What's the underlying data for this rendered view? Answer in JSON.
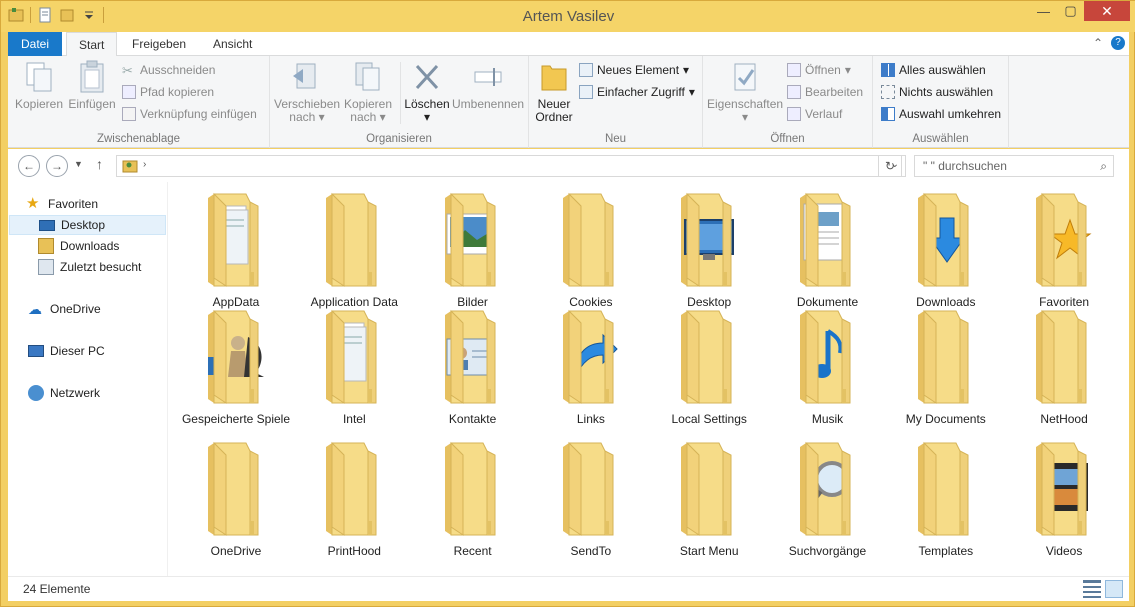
{
  "window": {
    "title": "Artem Vasilev"
  },
  "tabs": {
    "file": "Datei",
    "start": "Start",
    "share": "Freigeben",
    "view": "Ansicht"
  },
  "ribbon": {
    "clipboard": {
      "label": "Zwischenablage",
      "copy": "Kopieren",
      "paste": "Einfügen",
      "cut": "Ausschneiden",
      "copy_path": "Pfad kopieren",
      "paste_shortcut": "Verknüpfung einfügen"
    },
    "organize": {
      "label": "Organisieren",
      "move_to_1": "Verschieben",
      "move_to_2": "nach",
      "copy_to_1": "Kopieren",
      "copy_to_2": "nach",
      "delete": "Löschen",
      "rename": "Umbenennen"
    },
    "new": {
      "label": "Neu",
      "new_folder_1": "Neuer",
      "new_folder_2": "Ordner",
      "new_item": "Neues Element",
      "easy_access": "Einfacher Zugriff"
    },
    "open": {
      "label": "Öffnen",
      "properties": "Eigenschaften",
      "open": "Öffnen",
      "edit": "Bearbeiten",
      "history": "Verlauf"
    },
    "select": {
      "label": "Auswählen",
      "select_all": "Alles auswählen",
      "select_none": "Nichts auswählen",
      "invert": "Auswahl umkehren"
    }
  },
  "address": {
    "search_placeholder": "\"              \" durchsuchen"
  },
  "nav": {
    "favorites": "Favoriten",
    "desktop": "Desktop",
    "downloads": "Downloads",
    "recent": "Zuletzt besucht",
    "onedrive": "OneDrive",
    "thispc": "Dieser PC",
    "network": "Netzwerk"
  },
  "items": [
    {
      "label": "AppData",
      "icon": "papers"
    },
    {
      "label": "Application Data",
      "icon": "plain"
    },
    {
      "label": "Bilder",
      "icon": "picture"
    },
    {
      "label": "Cookies",
      "icon": "plain"
    },
    {
      "label": "Desktop",
      "icon": "monitor"
    },
    {
      "label": "Dokumente",
      "icon": "document"
    },
    {
      "label": "Downloads",
      "icon": "arrow-down"
    },
    {
      "label": "Favoriten",
      "icon": "star"
    },
    {
      "label": "Gespeicherte Spiele",
      "icon": "chess"
    },
    {
      "label": "Intel",
      "icon": "papers"
    },
    {
      "label": "Kontakte",
      "icon": "contact"
    },
    {
      "label": "Links",
      "icon": "link-arrow"
    },
    {
      "label": "Local Settings",
      "icon": "plain"
    },
    {
      "label": "Musik",
      "icon": "music"
    },
    {
      "label": "My Documents",
      "icon": "plain"
    },
    {
      "label": "NetHood",
      "icon": "plain"
    },
    {
      "label": "OneDrive",
      "icon": "plain"
    },
    {
      "label": "PrintHood",
      "icon": "plain"
    },
    {
      "label": "Recent",
      "icon": "plain"
    },
    {
      "label": "SendTo",
      "icon": "plain"
    },
    {
      "label": "Start Menu",
      "icon": "plain"
    },
    {
      "label": "Suchvorgänge",
      "icon": "magnifier"
    },
    {
      "label": "Templates",
      "icon": "plain"
    },
    {
      "label": "Videos",
      "icon": "film"
    }
  ],
  "status": {
    "count": "24 Elemente"
  },
  "colors": {
    "frame": "#f3cf63",
    "file_tab": "#1979ca",
    "close": "#c7463b",
    "folder": "#f2d27a"
  }
}
